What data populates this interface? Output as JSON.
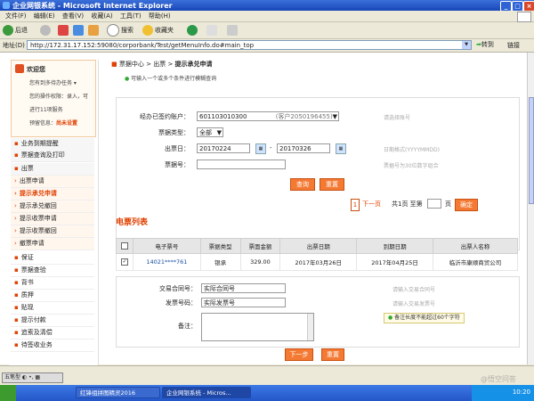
{
  "window": {
    "title": "企业网银系统 - Microsoft Internet Explorer"
  },
  "menu": [
    "文件(F)",
    "编辑(E)",
    "查看(V)",
    "收藏(A)",
    "工具(T)",
    "帮助(H)"
  ],
  "toolbar": {
    "back": "后退",
    "search": "搜索",
    "favorites": "收藏夹"
  },
  "address": {
    "label": "地址(D)",
    "url": "http://172.31.17.152:59080/corporbank/Test/getMenuInfo.do#main_top",
    "go": "转到",
    "links": "链接"
  },
  "sidebar": {
    "welcome": "欢迎您",
    "lines": [
      "您有到多待办任务 ▾",
      "您的操作权限：录入，可",
      "进行11项服务",
      "预留信息："
    ],
    "reserved": "尚未设置",
    "items": [
      "业务到期提醒",
      "票据查询及打印",
      "出票",
      "出票申请",
      "提示承兑申请",
      "提示承兑撤回",
      "提示收票申请",
      "提示收票撤回",
      "撤票申请",
      "保证",
      "票据查验",
      "背书",
      "质押",
      "贴现",
      "提示付款",
      "追索及清偿",
      "待签收业务"
    ]
  },
  "breadcrumb": {
    "a": "票据中心",
    "b": "出票",
    "c": "提示承兑申请",
    "sep": ">"
  },
  "note": "可输入一个或多个条件进行模糊查询",
  "query": {
    "account_label": "经办已签约账户：",
    "account_value": "601103010300",
    "account_suffix": "(客户2050196455)",
    "account_hint": "请选择账号",
    "type_label": "票据类型：",
    "type_value": "全部",
    "date_label": "出票日：",
    "date_from": "20170224",
    "date_to": "20170326",
    "date_sep": "-",
    "date_hint": "日期格式(YYYYMMDD)",
    "no_label": "票据号：",
    "no_hint": "票据号为30位数字组合",
    "btn_query": "查询",
    "btn_reset": "重置"
  },
  "pager": {
    "page": "1",
    "next": "下一页",
    "info": "共1页 至第",
    "unit": "页",
    "confirm": "确定"
  },
  "list_title": "电票列表",
  "table": {
    "headers": [
      "电子票号",
      "票据类型",
      "票面金额",
      "出票日期",
      "到期日期",
      "出票人名称"
    ],
    "rows": [
      [
        "14021****761",
        "银承",
        "329.00",
        "2017年03月26日",
        "2017年04月25日",
        "临沂市康顺商贸公司"
      ]
    ]
  },
  "form": {
    "contract_label": "交易合同号：",
    "contract_value": "实际合同号",
    "contract_hint": "请输入交易合同号",
    "invoice_label": "发票号码：",
    "invoice_value": "实际发票号",
    "invoice_hint": "请输入交易发票号",
    "remark_label": "备注：",
    "remark_warn": "备注长度不能超过60个字符",
    "btn_next": "下一步",
    "btn_reset": "重置"
  },
  "ime": "五笔型",
  "taskbar": {
    "task1": "红锋组拼图精灵2016",
    "task2": "企业网银系统 - Micros...",
    "clock": "10:20"
  },
  "watermark": "@悟空问答"
}
